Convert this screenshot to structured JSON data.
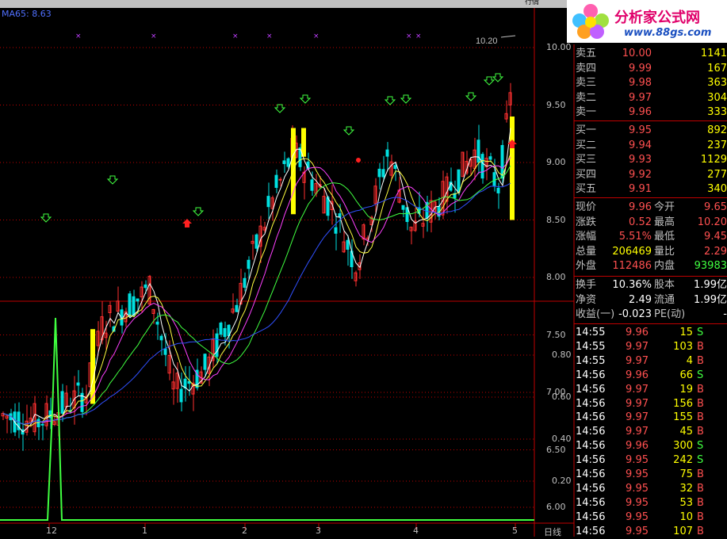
{
  "window": {
    "title_fragment": "",
    "tab": "行情"
  },
  "indicator": {
    "ma_label": "MA65: 8.63"
  },
  "logo": {
    "main": "分析家公式网",
    "url": "www.88gs.com"
  },
  "price_axis": [
    "10.00",
    "9.50",
    "9.00",
    "8.50",
    "8.00",
    "7.50",
    "7.00",
    "6.50",
    "6.00"
  ],
  "lower_axis": [
    "0.80",
    "0.60",
    "0.40",
    "0.20"
  ],
  "x_axis": [
    "12",
    "1",
    "2",
    "3",
    "4",
    "5"
  ],
  "period_label": "日线",
  "high_marker": "10.20",
  "order_book": {
    "asks": [
      {
        "label": "卖五",
        "price": "10.00",
        "vol": "1141"
      },
      {
        "label": "卖四",
        "price": "9.99",
        "vol": "167"
      },
      {
        "label": "卖三",
        "price": "9.98",
        "vol": "363"
      },
      {
        "label": "卖二",
        "price": "9.97",
        "vol": "304"
      },
      {
        "label": "卖一",
        "price": "9.96",
        "vol": "333"
      }
    ],
    "bids": [
      {
        "label": "买一",
        "price": "9.95",
        "vol": "892"
      },
      {
        "label": "买二",
        "price": "9.94",
        "vol": "237"
      },
      {
        "label": "买三",
        "price": "9.93",
        "vol": "1129"
      },
      {
        "label": "买四",
        "price": "9.92",
        "vol": "277"
      },
      {
        "label": "买五",
        "price": "9.91",
        "vol": "340"
      }
    ]
  },
  "stats": [
    {
      "l1": "现价",
      "v1": "9.96",
      "l2": "今开",
      "v2": "9.65"
    },
    {
      "l1": "涨跌",
      "v1": "0.52",
      "l2": "最高",
      "v2": "10.20"
    },
    {
      "l1": "涨幅",
      "v1": "5.51%",
      "l2": "最低",
      "v2": "9.45"
    },
    {
      "l1": "总量",
      "v1": "206469",
      "l2": "量比",
      "v2": "2.29"
    },
    {
      "l1": "外盘",
      "v1": "112486",
      "l2": "内盘",
      "v2": "93983"
    }
  ],
  "fundamentals": [
    {
      "l1": "换手",
      "v1": "10.36%",
      "l2": "股本",
      "v2": "1.99亿"
    },
    {
      "l1": "净资",
      "v1": "2.49",
      "l2": "流通",
      "v2": "1.99亿"
    },
    {
      "l1": "收益(一)",
      "v1": "-0.023",
      "l2": "PE(动)",
      "v2": "-"
    }
  ],
  "ticks": [
    {
      "time": "14:55",
      "price": "9.96",
      "vol": "15",
      "side": "S"
    },
    {
      "time": "14:55",
      "price": "9.97",
      "vol": "103",
      "side": "B"
    },
    {
      "time": "14:55",
      "price": "9.97",
      "vol": "4",
      "side": "B"
    },
    {
      "time": "14:56",
      "price": "9.96",
      "vol": "66",
      "side": "S"
    },
    {
      "time": "14:56",
      "price": "9.97",
      "vol": "19",
      "side": "B"
    },
    {
      "time": "14:56",
      "price": "9.97",
      "vol": "156",
      "side": "B"
    },
    {
      "time": "14:56",
      "price": "9.97",
      "vol": "155",
      "side": "B"
    },
    {
      "time": "14:56",
      "price": "9.97",
      "vol": "45",
      "side": "B"
    },
    {
      "time": "14:56",
      "price": "9.96",
      "vol": "300",
      "side": "S"
    },
    {
      "time": "14:56",
      "price": "9.95",
      "vol": "242",
      "side": "S"
    },
    {
      "time": "14:56",
      "price": "9.95",
      "vol": "75",
      "side": "B"
    },
    {
      "time": "14:56",
      "price": "9.95",
      "vol": "32",
      "side": "B"
    },
    {
      "time": "14:56",
      "price": "9.95",
      "vol": "53",
      "side": "B"
    },
    {
      "time": "14:56",
      "price": "9.95",
      "vol": "10",
      "side": "B"
    },
    {
      "time": "14:56",
      "price": "9.95",
      "vol": "107",
      "side": "B"
    }
  ],
  "colors": {
    "up": "#ff3030",
    "down": "#00e0e0",
    "signal": "#ffff00",
    "ma65": "#3050ff",
    "frame": "#c00000",
    "lower_line": "#40ff40"
  }
}
